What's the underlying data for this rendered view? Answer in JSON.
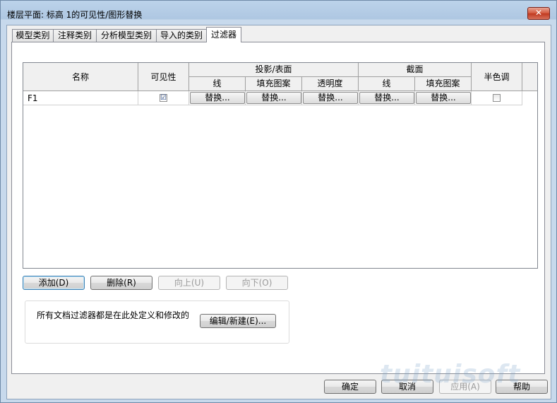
{
  "window": {
    "title": "楼层平面: 标高 1的可见性/图形替换",
    "close_label": "✕"
  },
  "tabs": [
    {
      "label": "模型类别"
    },
    {
      "label": "注释类别"
    },
    {
      "label": "分析模型类别"
    },
    {
      "label": "导入的类别"
    },
    {
      "label": "过滤器"
    }
  ],
  "grid": {
    "headers": {
      "name": "名称",
      "visibility": "可见性",
      "projection_surface": "投影/表面",
      "cut": "截面",
      "halftone": "半色调",
      "sub_line": "线",
      "sub_fill_pattern": "填充图案",
      "sub_transparency": "透明度",
      "cut_line": "线",
      "cut_fill_pattern": "填充图案"
    },
    "rows": [
      {
        "name": "F1",
        "visible": "☑",
        "proj_line": "替换...",
        "proj_pattern": "替换...",
        "proj_transparency": "替换...",
        "cut_line": "替换...",
        "cut_pattern": "替换...",
        "halftone": ""
      }
    ]
  },
  "actions": {
    "add": "添加(D)",
    "delete": "删除(R)",
    "up": "向上(U)",
    "down": "向下(O)"
  },
  "filters_group": {
    "text": "所有文档过滤器都是在此处定义和修改的",
    "edit_new": "编辑/新建(E)..."
  },
  "footer": {
    "ok": "确定",
    "cancel": "取消",
    "apply": "应用(A)",
    "help": "帮助"
  },
  "watermark": "tuituisoft"
}
